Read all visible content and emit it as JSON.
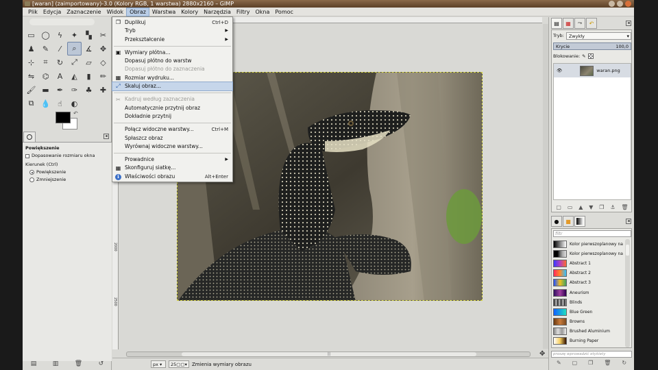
{
  "window": {
    "title": "[waran] (zaimportowany)-3.0 (Kolory RGB, 1 warstwa) 2880x2160 – GIMP"
  },
  "menubar": [
    {
      "label": "Plik",
      "name": "menu-file"
    },
    {
      "label": "Edycja",
      "name": "menu-edit"
    },
    {
      "label": "Zaznaczenie",
      "name": "menu-select"
    },
    {
      "label": "Widok",
      "name": "menu-view"
    },
    {
      "label": "Obraz",
      "name": "menu-image",
      "active": true
    },
    {
      "label": "Warstwa",
      "name": "menu-layer"
    },
    {
      "label": "Kolory",
      "name": "menu-colors"
    },
    {
      "label": "Narzędzia",
      "name": "menu-tools"
    },
    {
      "label": "Filtry",
      "name": "menu-filters"
    },
    {
      "label": "Okna",
      "name": "menu-windows"
    },
    {
      "label": "Pomoc",
      "name": "menu-help"
    }
  ],
  "image_menu": [
    {
      "label": "Duplikuj",
      "shortcut": "Ctrl+D",
      "icon": "duplicate-icon",
      "glyph": "❐"
    },
    {
      "label": "Tryb",
      "submenu": true
    },
    {
      "label": "Przekształcenie",
      "submenu": true
    },
    {
      "sep": true
    },
    {
      "label": "Wymiary płótna...",
      "icon": "canvas-size-icon",
      "glyph": "▣"
    },
    {
      "label": "Dopasuj płótno do warstw"
    },
    {
      "label": "Dopasuj płótno do zaznaczenia",
      "disabled": true
    },
    {
      "label": "Rozmiar wydruku...",
      "icon": "print-size-icon",
      "glyph": "▦"
    },
    {
      "label": "Skaluj obraz...",
      "icon": "scale-image-icon",
      "glyph": "⤢",
      "hover": true
    },
    {
      "sep": true
    },
    {
      "label": "Kadruj według zaznaczenia",
      "icon": "crop-icon",
      "glyph": "✂",
      "disabled": true
    },
    {
      "label": "Automatycznie przytnij obraz"
    },
    {
      "label": "Dokładnie przytnij"
    },
    {
      "sep": true
    },
    {
      "label": "Połącz widoczne warstwy...",
      "shortcut": "Ctrl+M"
    },
    {
      "label": "Spłaszcz obraz"
    },
    {
      "label": "Wyrównaj widoczne warstwy..."
    },
    {
      "sep": true
    },
    {
      "label": "Prowadnice",
      "submenu": true
    },
    {
      "label": "Skonfiguruj siatkę...",
      "icon": "grid-icon",
      "glyph": "▦"
    },
    {
      "label": "Właściwości obrazu",
      "shortcut": "Alt+Enter",
      "icon": "info-icon",
      "glyph": "ℹ"
    }
  ],
  "tools": [
    {
      "name": "rect-select-icon",
      "glyph": "▭"
    },
    {
      "name": "ellipse-select-icon",
      "glyph": "◯"
    },
    {
      "name": "free-select-icon",
      "glyph": "ϟ"
    },
    {
      "name": "fuzzy-select-icon",
      "glyph": "✦"
    },
    {
      "name": "color-select-icon",
      "glyph": "▚"
    },
    {
      "name": "scissors-select-icon",
      "glyph": "✂"
    },
    {
      "name": "foreground-select-icon",
      "glyph": "♟"
    },
    {
      "name": "paths-icon",
      "glyph": "✎"
    },
    {
      "name": "color-picker-icon",
      "glyph": "⁄"
    },
    {
      "name": "zoom-icon",
      "glyph": "⌕",
      "active": true
    },
    {
      "name": "measure-icon",
      "glyph": "∡"
    },
    {
      "name": "move-icon",
      "glyph": "✥"
    },
    {
      "name": "align-icon",
      "glyph": "⊹"
    },
    {
      "name": "crop-tool-icon",
      "glyph": "⌗"
    },
    {
      "name": "rotate-icon",
      "glyph": "↻"
    },
    {
      "name": "scale-icon",
      "glyph": "⤢"
    },
    {
      "name": "shear-icon",
      "glyph": "▱"
    },
    {
      "name": "perspective-icon",
      "glyph": "◇"
    },
    {
      "name": "flip-icon",
      "glyph": "⇋"
    },
    {
      "name": "cage-icon",
      "glyph": "⌬"
    },
    {
      "name": "text-icon",
      "glyph": "A"
    },
    {
      "name": "bucket-fill-icon",
      "glyph": "◭"
    },
    {
      "name": "blend-icon",
      "glyph": "▮"
    },
    {
      "name": "pencil-icon",
      "glyph": "✏"
    },
    {
      "name": "paintbrush-icon",
      "glyph": "🖌"
    },
    {
      "name": "eraser-icon",
      "glyph": "▬"
    },
    {
      "name": "airbrush-icon",
      "glyph": "✒"
    },
    {
      "name": "ink-icon",
      "glyph": "✑"
    },
    {
      "name": "clone-icon",
      "glyph": "♣"
    },
    {
      "name": "heal-icon",
      "glyph": "✚"
    },
    {
      "name": "perspective-clone-icon",
      "glyph": "⧉"
    },
    {
      "name": "blur-icon",
      "glyph": "💧"
    },
    {
      "name": "smudge-icon",
      "glyph": "☝"
    },
    {
      "name": "dodge-burn-icon",
      "glyph": "◐"
    }
  ],
  "colors": {
    "foreground": "#000000",
    "background": "#ffffff"
  },
  "tool_options": {
    "title": "Powiększenie",
    "auto_resize_label": "Dopasowanie rozmiaru okna",
    "direction_label": "Kierunek  (Ctrl)",
    "zoom_in_label": "Powiększenie",
    "zoom_out_label": "Zmniejszenie"
  },
  "statusbar": {
    "unit": "px",
    "zoom": "25",
    "message": "Zmienia wymiary obrazu"
  },
  "layers_panel": {
    "mode_label": "Tryb:",
    "mode_value": "Zwykły",
    "opacity_label": "Krycie",
    "opacity_value": "100,0",
    "lock_label": "Blokowanie:",
    "layer_name": "waran.png"
  },
  "gradients_panel": {
    "filter_placeholder": "filtr",
    "tag_placeholder": "proszę wprowadzić etykiety",
    "items": [
      {
        "name": "Kolor pierwszoplanowy na ko",
        "swatch": "linear-gradient(90deg,#000,#fff)"
      },
      {
        "name": "Kolor pierwszoplanowy na pr",
        "swatch": "linear-gradient(90deg,#000,#000 30%,#666 50%,#aaa 70%,#ddd)"
      },
      {
        "name": "Abstract 1",
        "swatch": "linear-gradient(90deg,#3a3aff,#b040c0,#ff6a30)"
      },
      {
        "name": "Abstract 2",
        "swatch": "linear-gradient(90deg,#ff2a5a,#ff8a2a,#30c0ff)"
      },
      {
        "name": "Abstract 3",
        "swatch": "linear-gradient(90deg,#2050ff,#f0c020,#40a060)"
      },
      {
        "name": "Aneurism",
        "swatch": "linear-gradient(90deg,#301060,#a040a0,#300050)"
      },
      {
        "name": "Blinds",
        "swatch": "repeating-linear-gradient(90deg,#222 0,#ccc 4px,#222 5px)"
      },
      {
        "name": "Blue Green",
        "swatch": "linear-gradient(90deg,#1060ff,#20e0c0)"
      },
      {
        "name": "Browns",
        "swatch": "linear-gradient(90deg,#6a3a10,#c87a3a,#7a4a20)"
      },
      {
        "name": "Brushed Aluminium",
        "swatch": "linear-gradient(90deg,#888,#ddd,#999,#eee)"
      },
      {
        "name": "Burning Paper",
        "swatch": "linear-gradient(90deg,#fff,#f8d060,#301000)"
      }
    ]
  }
}
